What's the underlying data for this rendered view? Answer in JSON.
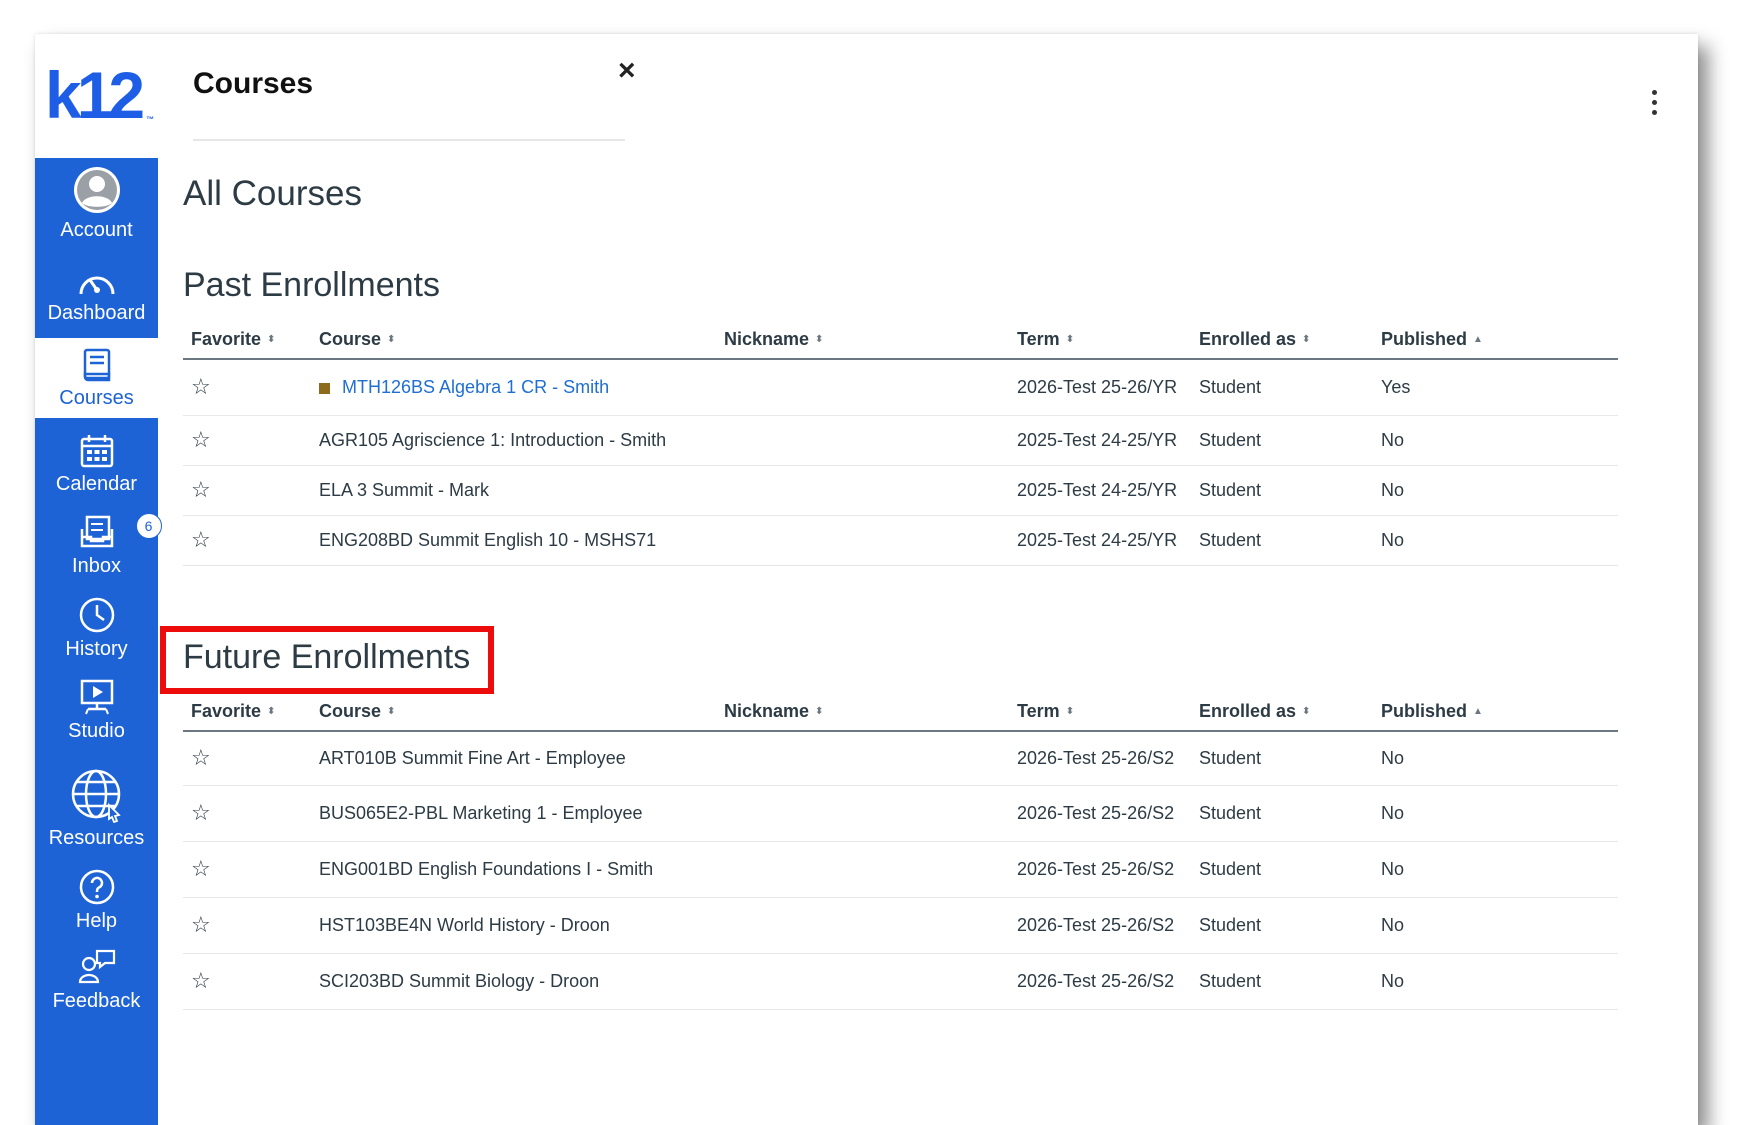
{
  "logo": {
    "text": "k12",
    "tm": "™"
  },
  "nav": {
    "account": "Account",
    "dashboard": "Dashboard",
    "courses": "Courses",
    "calendar": "Calendar",
    "inbox": "Inbox",
    "inbox_badge": "6",
    "history": "History",
    "studio": "Studio",
    "resources": "Resources",
    "help": "Help",
    "feedback": "Feedback"
  },
  "tray": {
    "title": "Courses",
    "close": "×"
  },
  "page": {
    "title": "All Courses"
  },
  "columns": {
    "favorite": "Favorite",
    "course": "Course",
    "nickname": "Nickname",
    "term": "Term",
    "enrolled_as": "Enrolled as",
    "published": "Published"
  },
  "past": {
    "heading": "Past Enrollments",
    "rows": [
      {
        "course": "MTH126BS Algebra 1 CR - Smith",
        "nickname": "",
        "term": "2026-Test 25-26/YR",
        "enrolled_as": "Student",
        "published": "Yes"
      },
      {
        "course": "AGR105 Agriscience 1: Introduction - Smith",
        "nickname": "",
        "term": "2025-Test 24-25/YR",
        "enrolled_as": "Student",
        "published": "No"
      },
      {
        "course": "ELA 3 Summit - Mark",
        "nickname": "",
        "term": "2025-Test 24-25/YR",
        "enrolled_as": "Student",
        "published": "No"
      },
      {
        "course": "ENG208BD Summit English 10 - MSHS71",
        "nickname": "",
        "term": "2025-Test 24-25/YR",
        "enrolled_as": "Student",
        "published": "No"
      }
    ]
  },
  "future": {
    "heading": "Future Enrollments",
    "rows": [
      {
        "course": "ART010B Summit Fine Art - Employee",
        "nickname": "",
        "term": "2026-Test 25-26/S2",
        "enrolled_as": "Student",
        "published": "No"
      },
      {
        "course": "BUS065E2-PBL Marketing 1 - Employee",
        "nickname": "",
        "term": "2026-Test 25-26/S2",
        "enrolled_as": "Student",
        "published": "No"
      },
      {
        "course": "ENG001BD English Foundations I - Smith",
        "nickname": "",
        "term": "2026-Test 25-26/S2",
        "enrolled_as": "Student",
        "published": "No"
      },
      {
        "course": "HST103BE4N World History - Droon",
        "nickname": "",
        "term": "2026-Test 25-26/S2",
        "enrolled_as": "Student",
        "published": "No"
      },
      {
        "course": "SCI203BD Summit Biology - Droon",
        "nickname": "",
        "term": "2026-Test 25-26/S2",
        "enrolled_as": "Student",
        "published": "No"
      }
    ]
  },
  "icons": {
    "star": "☆",
    "sort_both": "⬍",
    "sort_up": "▲"
  },
  "colors": {
    "sidebar": "#1e63d6",
    "link": "#1f6fd1",
    "highlight": "#ec0c0c",
    "course_swatch": "#8d6b1b"
  }
}
